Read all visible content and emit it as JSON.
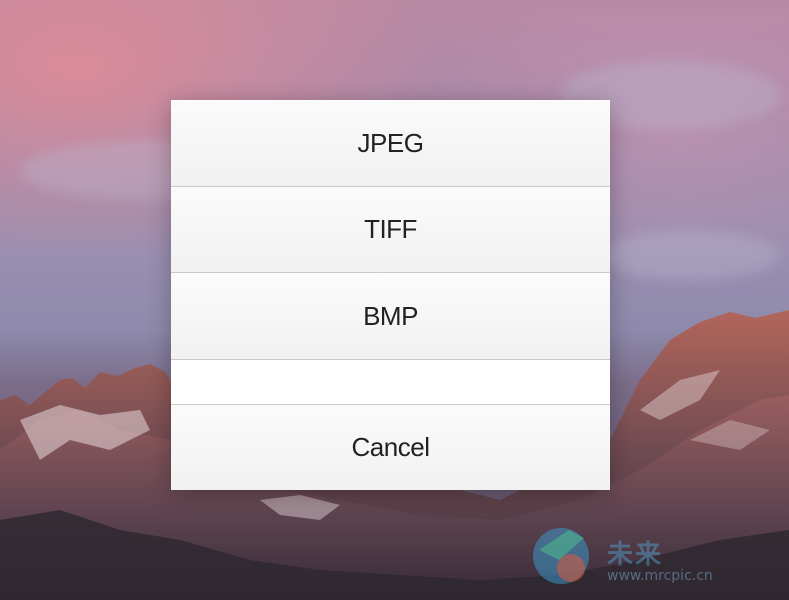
{
  "dialog": {
    "options": [
      {
        "label": "JPEG"
      },
      {
        "label": "TIFF"
      },
      {
        "label": "BMP"
      }
    ],
    "cancel_label": "Cancel"
  },
  "watermark": {
    "text": "未来",
    "url": "www.mrcpic.cn"
  },
  "background": {
    "description_icon": "mountain-landscape-icon"
  }
}
